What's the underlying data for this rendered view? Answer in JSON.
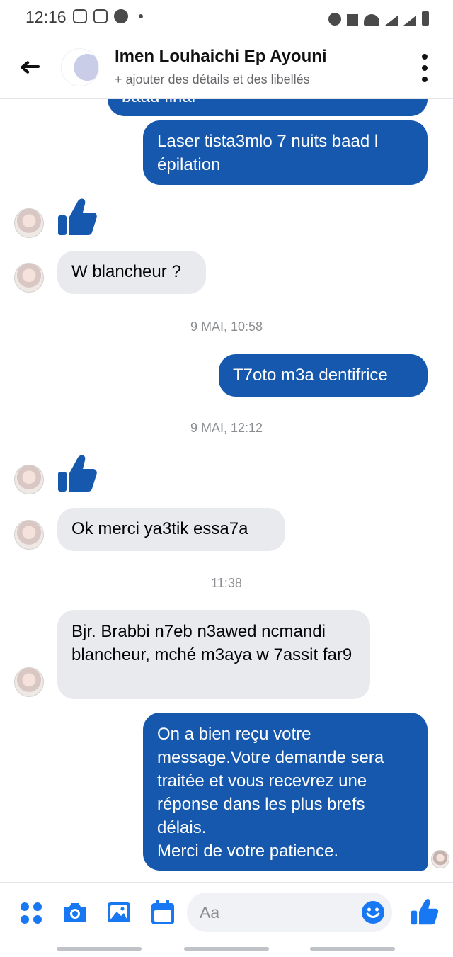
{
  "status_bar": {
    "time": "12:16"
  },
  "header": {
    "contact_name": "Imen Louhaichi Ep Ayouni",
    "subtitle": "+ ajouter des détails et des libellés"
  },
  "messages": {
    "out_cut": "baad final",
    "out_laser": "Laser tista3mlo 7 nuits baad l épilation",
    "in_blancheur": "W blancheur ?",
    "ts_1": "9 MAI, 10:58",
    "out_toto": "T7oto m3a dentifrice",
    "ts_2": "9 MAI, 12:12",
    "in_ok": "Ok merci ya3tik essa7a",
    "ts_3": "11:38",
    "in_bjr": "Bjr. Brabbi n7eb n3awed ncmandi blancheur, mché m3aya w 7assit far9",
    "out_auto_1": "On a bien reçu votre message.Votre demande sera traitée et vous recevrez une réponse dans les plus brefs délais.",
    "out_auto_2": "Merci de votre patience."
  },
  "composer": {
    "placeholder": "Aa"
  },
  "colors": {
    "brand_blue": "#1558ad",
    "icon_blue": "#1877f2",
    "incoming_bg": "#e9eaee"
  },
  "icons": [
    "back-arrow-icon",
    "more-options-icon",
    "like-icon",
    "menu-grid-icon",
    "camera-icon",
    "gallery-icon",
    "calendar-icon",
    "emoji-icon"
  ]
}
